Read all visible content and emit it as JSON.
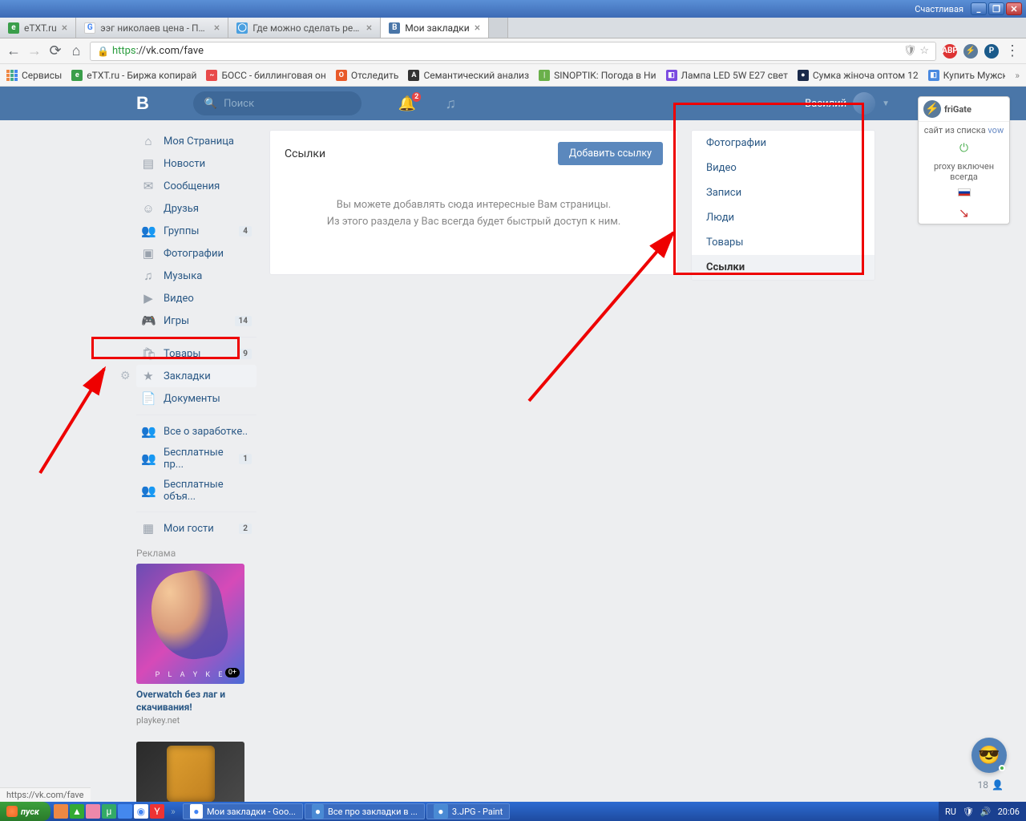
{
  "os": {
    "user": "Счастливая",
    "start": "пуск",
    "lang": "RU",
    "clock": "20:06",
    "status_url": "https://vk.com/fave",
    "task_apps": [
      {
        "label": "Мои закладки - Goo...",
        "color": "#fff"
      },
      {
        "label": "Все про закладки в ...",
        "color": "#4a8ad4"
      },
      {
        "label": "3.JPG - Paint",
        "color": "#4a8ad4"
      }
    ]
  },
  "browser": {
    "tabs": [
      {
        "title": "eTXT.ru",
        "fav_bg": "#3a9e4a",
        "fav_text": "e",
        "active": false
      },
      {
        "title": "ээг николаев цена - Поиск",
        "fav_bg": "#fff",
        "fav_text": "G",
        "active": false
      },
      {
        "title": "Где можно сделать ребенк",
        "fav_bg": "#4aa0e0",
        "fav_text": "◯",
        "active": false
      },
      {
        "title": "Мои закладки",
        "fav_bg": "#4a76a8",
        "fav_text": "B",
        "active": true
      }
    ],
    "url_proto": "https",
    "url_rest": "://vk.com/fave",
    "bookmarks_label": "Сервисы",
    "bookmarks": [
      {
        "label": "eTXT.ru - Биржа копирай",
        "bg": "#3a9e4a",
        "t": "e"
      },
      {
        "label": "БОСС - биллинговая он",
        "bg": "#e84a4a",
        "t": "~"
      },
      {
        "label": "Отследить",
        "bg": "#e85a2a",
        "t": "О"
      },
      {
        "label": "Семантический анализ",
        "bg": "#333",
        "t": "A"
      },
      {
        "label": "SINOPTIK: Погода в Ни",
        "bg": "#6ab04a",
        "t": "|"
      },
      {
        "label": "Лампа LED 5W E27 свет",
        "bg": "#7a4ae0",
        "t": "◧"
      },
      {
        "label": "Сумка жіноча оптом 12",
        "bg": "#1a2a4a",
        "t": "●"
      },
      {
        "label": "Купить Мужская Рубаш",
        "bg": "#4a8ae0",
        "t": "◧"
      }
    ]
  },
  "vk": {
    "search_placeholder": "Поиск",
    "notif_count": "2",
    "username": "Василий",
    "nav": [
      {
        "label": "Моя Страница",
        "icon": "⌂",
        "count": ""
      },
      {
        "label": "Новости",
        "icon": "▤",
        "count": ""
      },
      {
        "label": "Сообщения",
        "icon": "✉",
        "count": ""
      },
      {
        "label": "Друзья",
        "icon": "☺",
        "count": ""
      },
      {
        "label": "Группы",
        "icon": "👥",
        "count": "4"
      },
      {
        "label": "Фотографии",
        "icon": "▣",
        "count": ""
      },
      {
        "label": "Музыка",
        "icon": "♫",
        "count": ""
      },
      {
        "label": "Видео",
        "icon": "▶",
        "count": ""
      },
      {
        "label": "Игры",
        "icon": "🎮",
        "count": "14"
      }
    ],
    "nav2": [
      {
        "label": "Товары",
        "icon": "🛍",
        "count": "9"
      },
      {
        "label": "Закладки",
        "icon": "★",
        "count": "",
        "active": true,
        "gear": true
      },
      {
        "label": "Документы",
        "icon": "📄",
        "count": ""
      }
    ],
    "nav3": [
      {
        "label": "Все о заработке..",
        "icon": "👥",
        "count": ""
      },
      {
        "label": "Бесплатные пр...",
        "icon": "👥",
        "count": "1"
      },
      {
        "label": "Бесплатные объя...",
        "icon": "👥",
        "count": ""
      }
    ],
    "nav4": [
      {
        "label": "Мои гости",
        "icon": "▦",
        "count": "2"
      }
    ],
    "ad_label": "Реклама",
    "ad_brand": "P L A Y K E",
    "ad_badge": "0+",
    "ad_title": "Overwatch без лаг и скачивания!",
    "ad_domain": "playkey.net",
    "panel_title": "Ссылки",
    "panel_btn": "Добавить ссылку",
    "empty_line1": "Вы можете добавлять сюда интересные Вам страницы.",
    "empty_line2": "Из этого раздела у Вас всегда будет быстрый доступ к ним.",
    "tabs": [
      {
        "label": "Фотографии"
      },
      {
        "label": "Видео"
      },
      {
        "label": "Записи"
      },
      {
        "label": "Люди"
      },
      {
        "label": "Товары"
      },
      {
        "label": "Ссылки",
        "active": true
      }
    ]
  },
  "frigate": {
    "title": "friGate",
    "row1a": "сайт из списка ",
    "row1b": "vow",
    "row2": "proxy включен всегда"
  },
  "voice_count": "18"
}
